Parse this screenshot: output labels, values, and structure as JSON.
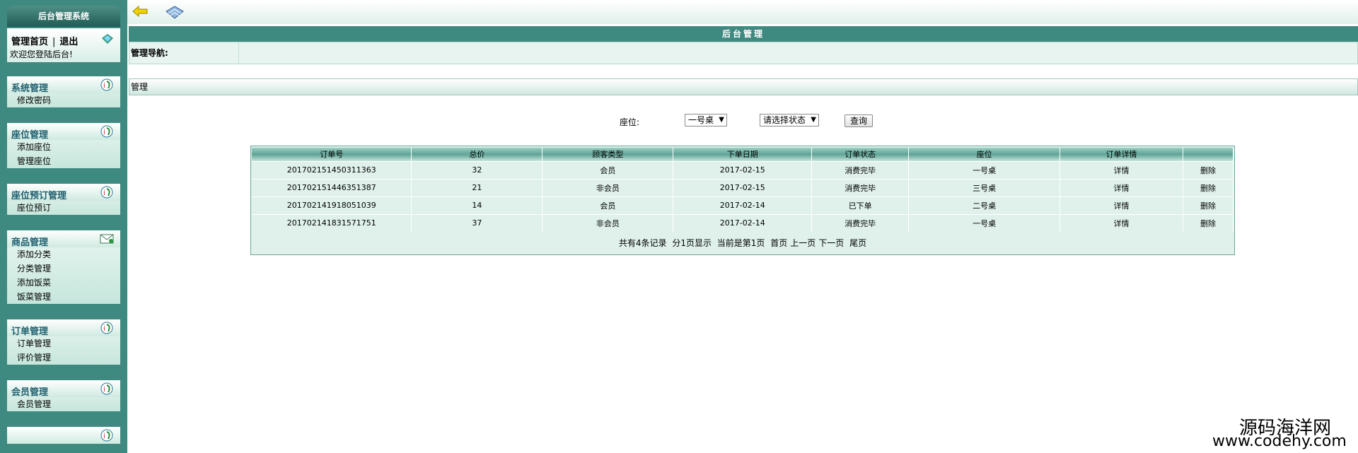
{
  "sidebar": {
    "title": "后台管理系统",
    "user": {
      "home_link": "管理首页",
      "separator": "|",
      "logout_link": "退出",
      "welcome": "欢迎您登陆后台!"
    },
    "menus": [
      {
        "title": "系统管理",
        "items": [
          "修改密码"
        ]
      },
      {
        "title": "座位管理",
        "items": [
          "添加座位",
          "管理座位"
        ]
      },
      {
        "title": "座位预订管理",
        "items": [
          "座位预订"
        ]
      },
      {
        "title": "商品管理",
        "items": [
          "添加分类",
          "分类管理",
          "添加饭菜",
          "饭菜管理"
        ]
      },
      {
        "title": "订单管理",
        "items": [
          "订单管理",
          "评价管理"
        ]
      },
      {
        "title": "会员管理",
        "items": [
          "会员管理"
        ]
      },
      {
        "title": "",
        "items": []
      }
    ]
  },
  "header": {
    "title": "后台管理",
    "nav_label": "管理导航:"
  },
  "section_title": "管理",
  "filters": {
    "seat_label": "座位:",
    "seat_selected": "一号桌",
    "status_selected": "请选择状态",
    "query_button": "查询"
  },
  "table": {
    "columns": [
      "订单号",
      "总价",
      "顾客类型",
      "下单日期",
      "订单状态",
      "座位",
      "订单详情",
      ""
    ],
    "rows": [
      [
        "201702151450311363",
        "32",
        "会员",
        "2017-02-15",
        "消费完毕",
        "一号桌",
        "详情",
        "删除"
      ],
      [
        "201702151446351387",
        "21",
        "非会员",
        "2017-02-15",
        "消费完毕",
        "三号桌",
        "详情",
        "删除"
      ],
      [
        "201702141918051039",
        "14",
        "会员",
        "2017-02-14",
        "已下单",
        "二号桌",
        "详情",
        "删除"
      ],
      [
        "201702141831571751",
        "37",
        "非会员",
        "2017-02-14",
        "消费完毕",
        "一号桌",
        "详情",
        "删除"
      ]
    ]
  },
  "pager": {
    "total": "共有4条记录",
    "pages": "分1页显示",
    "current": "当前是第1页",
    "first": "首页",
    "prev": "上一页",
    "next": "下一页",
    "last": "尾页"
  },
  "watermark": {
    "line1": "源码海洋网",
    "line2": "www.codehy.com"
  },
  "colors": {
    "sidebar_bg": "#3e8a80",
    "header_bg": "#3e8a80",
    "table_bg": "#dff1ea",
    "menu_title": "#1f5f6f"
  },
  "icons": {
    "back": "back-arrow-icon",
    "notebook": "notebook-icon",
    "menu_badge": "info-badge-icon"
  }
}
